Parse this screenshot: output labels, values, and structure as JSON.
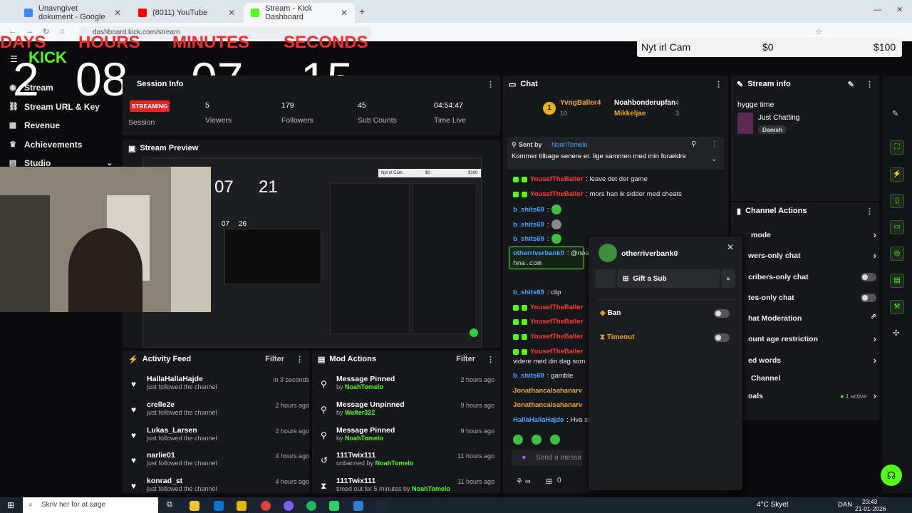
{
  "browser": {
    "tabs": [
      {
        "title": "Unavngivet dokument - Google",
        "color": "#4285f4"
      },
      {
        "title": "(8011) YouTube",
        "color": "#ff0000"
      },
      {
        "title": "Stream - Kick Dashboard",
        "color": "#53fc18"
      }
    ],
    "url": "dashboard.kick.com/stream"
  },
  "goal": {
    "title": "Nyt irl Cam",
    "current": "$0",
    "target": "$100"
  },
  "countdown": {
    "labels": [
      "DAYS",
      "HOURS",
      "MINUTES",
      "SECONDS"
    ],
    "values": [
      "2",
      "08",
      "07",
      "15"
    ]
  },
  "sidebar": {
    "logo": "KICK",
    "items": [
      {
        "label": "Stream",
        "icon": "stream-icon"
      },
      {
        "label": "Stream URL & Key",
        "icon": "link-icon"
      },
      {
        "label": "Revenue",
        "icon": "revenue-icon"
      },
      {
        "label": "Achievements",
        "icon": "trophy-icon"
      },
      {
        "label": "Studio",
        "icon": "studio-icon"
      }
    ]
  },
  "session": {
    "title": "Session Info",
    "status": "STREAMING",
    "stats": [
      {
        "value": "5",
        "label": "Viewers"
      },
      {
        "value": "179",
        "label": "Followers"
      },
      {
        "value": "45",
        "label": "Sub Counts"
      },
      {
        "value": "04:54:47",
        "label": "Time Live"
      }
    ],
    "session_label": "Session"
  },
  "preview": {
    "title": "Stream Preview",
    "inner_values": [
      "07",
      "21"
    ],
    "inner2_values": [
      "07",
      "26"
    ],
    "inner_goal": "Nyt irl Cam",
    "inner_goal_cur": "$0",
    "inner_goal_tgt": "$100"
  },
  "chat": {
    "title": "Chat",
    "top_gifters": [
      {
        "name": "YvngBaller4",
        "count": "10"
      },
      {
        "name": "Noahbonderupfan",
        "count": "4"
      },
      {
        "name": "Mikkeljae",
        "count": "3"
      }
    ],
    "pinned": {
      "sent_by_label": "Sent by",
      "sender": "NoahTomelo",
      "text": "Kommer tilbage senere er. lige sammen med min forældre"
    },
    "messages": [
      {
        "user": "YousefTheBaller",
        "text": ": leave det der game",
        "cls": "u-red"
      },
      {
        "user": "YousefTheBaller",
        "text": ": mors han ik sidder med cheats",
        "cls": "u-red"
      },
      {
        "user": "b_shits69",
        "text": ":",
        "cls": "u-blue"
      },
      {
        "user": "b_shits69",
        "text": ":",
        "cls": "u-blue"
      },
      {
        "user": "b_shits69",
        "text": ":",
        "cls": "u-blue"
      },
      {
        "user": "otherriverbank0",
        "text": ": @noa",
        "cls": "u-blue"
      },
      {
        "user": "b_shits69",
        "text": ": clip",
        "cls": "u-blue"
      },
      {
        "user": "YousefTheBaller",
        "text": "",
        "cls": "u-red"
      },
      {
        "user": "YousefTheBaller",
        "text": "",
        "cls": "u-red"
      },
      {
        "user": "YousefTheBaller",
        "text": "",
        "cls": "u-red"
      },
      {
        "user": "YousefTheBaller",
        "text": "",
        "cls": "u-red"
      }
    ],
    "hna": "hna.com",
    "line_videre": "videre med din dag som",
    "gamble_user": "b_shits69",
    "gamble_text": ": gamble",
    "jon1": "Jonathancalsahanarv",
    "jon2": "Jonathancalsahanarv",
    "halla_user": "HallaHallaHajde",
    "halla_text": ": Hva sl",
    "input_placeholder": "Send a messa",
    "footer_count": "0"
  },
  "user_card": {
    "name": "otherriverbank0",
    "gift_label": "Gift a Sub",
    "ban_label": "Ban",
    "timeout_label": "Timeout"
  },
  "stream_info": {
    "title": "Stream info",
    "stream_title": "hygge time",
    "category": "Just Chatting",
    "tag": "Danish"
  },
  "channel_actions": {
    "title": "Channel Actions",
    "rows": [
      {
        "label": "mode",
        "type": "chevron"
      },
      {
        "label": "wers-only chat",
        "type": "chevron"
      },
      {
        "label": "cribers-only chat",
        "type": "toggle"
      },
      {
        "label": "tes-only chat",
        "type": "toggle"
      },
      {
        "label": "hat Moderation",
        "type": "external"
      },
      {
        "label": "ount age restriction",
        "type": "chevron"
      },
      {
        "label": "ed words",
        "type": "chevron"
      },
      {
        "label": "Channel",
        "type": "none"
      },
      {
        "label": "oals",
        "type": "active"
      }
    ],
    "active_text": "1 active"
  },
  "activity_feed": {
    "title": "Activity Feed",
    "filter": "Filter",
    "items": [
      {
        "name": "HallaHallaHajde",
        "sub": "just followed the channel",
        "time": "in 3 seconds"
      },
      {
        "name": "crelle2e",
        "sub": "just followed the channel",
        "time": "2 hours ago"
      },
      {
        "name": "Lukas_Larsen",
        "sub": "just followed the channel",
        "time": "2 hours ago"
      },
      {
        "name": "narlie01",
        "sub": "just followed the channel",
        "time": "4 hours ago"
      },
      {
        "name": "konrad_st",
        "sub": "just followed the channel",
        "time": "4 hours ago"
      }
    ]
  },
  "mod_actions": {
    "title": "Mod Actions",
    "filter": "Filter",
    "items": [
      {
        "action": "Message Pinned",
        "by": "by",
        "user": "NoahTomelo",
        "time": "2 hours ago",
        "icon": "pin-icon"
      },
      {
        "action": "Message Unpinned",
        "by": "by",
        "user": "Walter322",
        "time": "9 hours ago",
        "icon": "unpin-icon"
      },
      {
        "action": "Message Pinned",
        "by": "by",
        "user": "NoahTomelo",
        "time": "9 hours ago",
        "icon": "pin-icon"
      },
      {
        "action": "111Twix111",
        "by": "unbanned by",
        "user": "NoahTomelo",
        "time": "11 hours ago",
        "icon": "undo-icon"
      },
      {
        "action": "111Twix111",
        "by": "timed out for 5 minutes by",
        "user": "NoahTomelo",
        "time": "11 hours ago",
        "icon": "hourglass-icon"
      }
    ]
  },
  "taskbar": {
    "search_placeholder": "Skriv her for at søge",
    "weather": "4°C Skyet",
    "lang": "DAN",
    "time": "23:43",
    "date": "21-01-2026"
  },
  "colors": {
    "accent": "#53fc18",
    "danger": "#ff2a2a",
    "panel": "#17181b"
  }
}
